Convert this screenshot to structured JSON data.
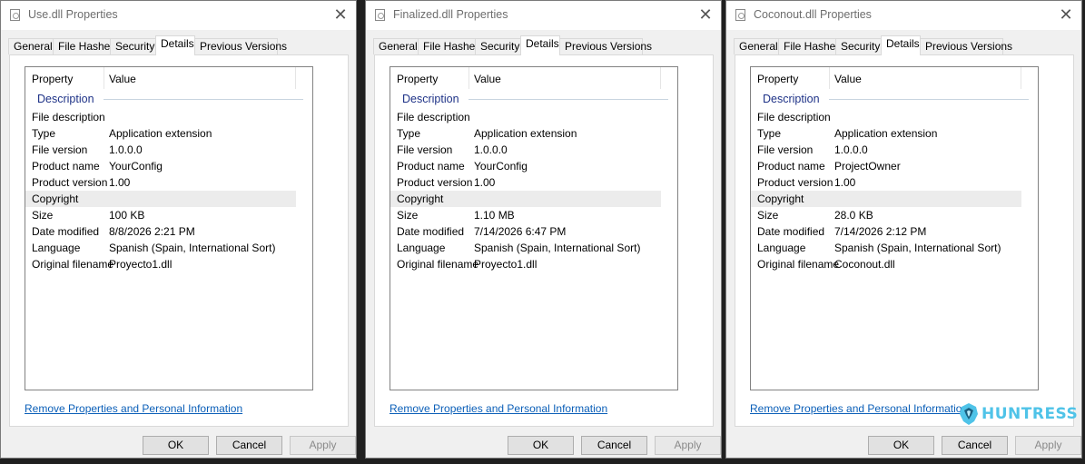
{
  "tabs": [
    "General",
    "File Hashes",
    "Security",
    "Details",
    "Previous Versions"
  ],
  "active_tab": "Details",
  "columns": {
    "property": "Property",
    "value": "Value"
  },
  "group_label": "Description",
  "link_text": "Remove Properties and Personal Information",
  "buttons": {
    "ok": "OK",
    "cancel": "Cancel",
    "apply": "Apply"
  },
  "windows": [
    {
      "title": "Use.dll Properties",
      "rows": [
        {
          "k": "File description",
          "v": ""
        },
        {
          "k": "Type",
          "v": "Application extension"
        },
        {
          "k": "File version",
          "v": "1.0.0.0"
        },
        {
          "k": "Product name",
          "v": "YourConfig"
        },
        {
          "k": "Product version",
          "v": "1.00"
        },
        {
          "k": "Copyright",
          "v": ""
        },
        {
          "k": "Size",
          "v": "100 KB"
        },
        {
          "k": "Date modified",
          "v": "8/8/2026 2:21 PM"
        },
        {
          "k": "Language",
          "v": "Spanish (Spain, International Sort)"
        },
        {
          "k": "Original filename",
          "v": "Proyecto1.dll"
        }
      ]
    },
    {
      "title": "Finalized.dll Properties",
      "rows": [
        {
          "k": "File description",
          "v": ""
        },
        {
          "k": "Type",
          "v": "Application extension"
        },
        {
          "k": "File version",
          "v": "1.0.0.0"
        },
        {
          "k": "Product name",
          "v": "YourConfig"
        },
        {
          "k": "Product version",
          "v": "1.00"
        },
        {
          "k": "Copyright",
          "v": ""
        },
        {
          "k": "Size",
          "v": "1.10 MB"
        },
        {
          "k": "Date modified",
          "v": "7/14/2026 6:47 PM"
        },
        {
          "k": "Language",
          "v": "Spanish (Spain, International Sort)"
        },
        {
          "k": "Original filename",
          "v": "Proyecto1.dll"
        }
      ]
    },
    {
      "title": "Coconout.dll Properties",
      "rows": [
        {
          "k": "File description",
          "v": ""
        },
        {
          "k": "Type",
          "v": "Application extension"
        },
        {
          "k": "File version",
          "v": "1.0.0.0"
        },
        {
          "k": "Product name",
          "v": "ProjectOwner"
        },
        {
          "k": "Product version",
          "v": "1.00"
        },
        {
          "k": "Copyright",
          "v": ""
        },
        {
          "k": "Size",
          "v": "28.0 KB"
        },
        {
          "k": "Date modified",
          "v": "7/14/2026 2:12 PM"
        },
        {
          "k": "Language",
          "v": "Spanish (Spain, International Sort)"
        },
        {
          "k": "Original filename",
          "v": "Coconout.dll"
        }
      ]
    }
  ],
  "logo_text": "HUNTRESS",
  "colors": {
    "link": "#0b5fb8",
    "group": "#1e3287",
    "logo": "#4fc3e8"
  }
}
